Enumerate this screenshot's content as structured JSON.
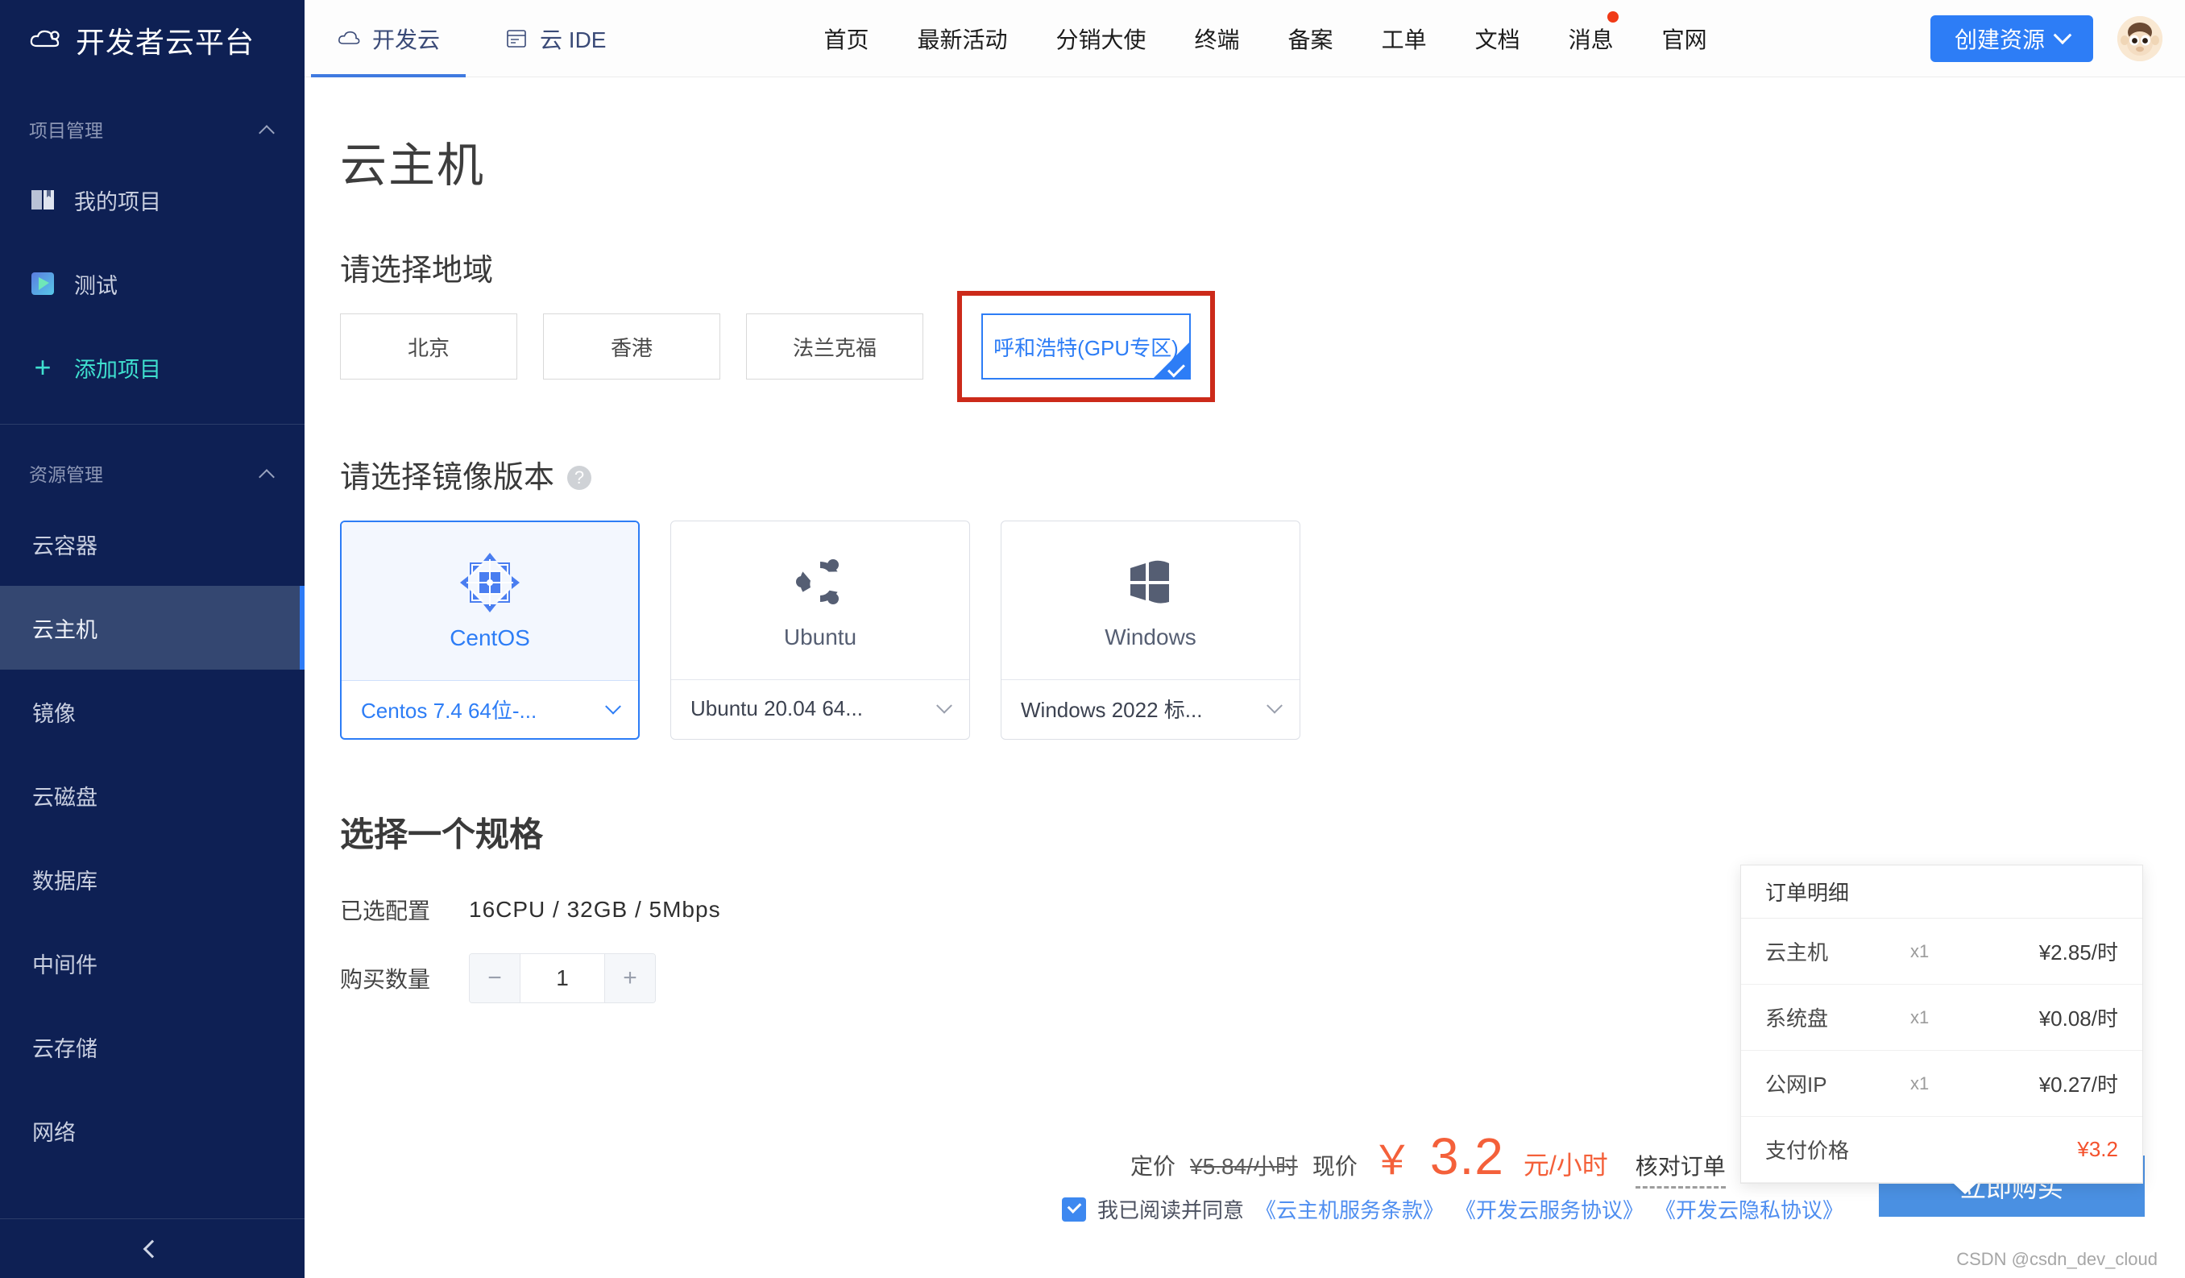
{
  "sidebar": {
    "brand": "开发者云平台",
    "groups": [
      {
        "title": "项目管理",
        "items": [
          {
            "label": "我的项目",
            "icon": "book-icon"
          },
          {
            "label": "测试",
            "icon": "project-icon"
          },
          {
            "label": "添加项目",
            "icon": "plus-icon"
          }
        ]
      },
      {
        "title": "资源管理",
        "items": [
          {
            "label": "云容器"
          },
          {
            "label": "云主机"
          },
          {
            "label": "镜像"
          },
          {
            "label": "云磁盘"
          },
          {
            "label": "数据库"
          },
          {
            "label": "中间件"
          },
          {
            "label": "云存储"
          },
          {
            "label": "网络"
          }
        ],
        "active_label": "云主机"
      }
    ],
    "collapse_icon": "chevron-left-icon"
  },
  "topnav": {
    "tabs": [
      {
        "label": "开发云",
        "icon": "cloud-icon",
        "active": true
      },
      {
        "label": "云 IDE",
        "icon": "ide-icon",
        "active": false
      }
    ],
    "links": [
      {
        "label": "首页"
      },
      {
        "label": "最新活动"
      },
      {
        "label": "分销大使"
      },
      {
        "label": "终端"
      },
      {
        "label": "备案"
      },
      {
        "label": "工单"
      },
      {
        "label": "文档"
      },
      {
        "label": "消息",
        "badge": true
      },
      {
        "label": "官网"
      }
    ],
    "create_button": "创建资源",
    "avatar": "user-avatar"
  },
  "page": {
    "title": "云主机",
    "region_section": {
      "title": "请选择地域",
      "regions": [
        {
          "label": "北京",
          "selected": false
        },
        {
          "label": "香港",
          "selected": false
        },
        {
          "label": "法兰克福",
          "selected": false
        },
        {
          "label": "呼和浩特(GPU专区)",
          "selected": true
        }
      ]
    },
    "image_section": {
      "title": "请选择镜像版本",
      "help_icon": "question-mark-icon",
      "images": [
        {
          "name": "CentOS",
          "version": "Centos 7.4 64位-...",
          "logo": "centos-logo",
          "selected": true
        },
        {
          "name": "Ubuntu",
          "version": "Ubuntu 20.04 64...",
          "logo": "ubuntu-logo",
          "selected": false
        },
        {
          "name": "Windows",
          "version": "Windows 2022 标...",
          "logo": "windows-logo",
          "selected": false
        }
      ]
    },
    "spec_section": {
      "title": "选择一个规格",
      "config_label": "已选配置",
      "config_value": "16CPU  /  32GB  /  5Mbps",
      "quantity_label": "购买数量",
      "quantity_value": "1",
      "decrement": "−",
      "increment": "+"
    }
  },
  "pricebar": {
    "list_price_label": "定价",
    "list_price": "¥5.84/小时",
    "current_price_label": "现价",
    "currency_symbol": "￥",
    "current_price": "3.2",
    "price_unit": "元/小时",
    "check_order": "核对订单",
    "agree_prefix": "我已阅读并同意",
    "agreements": [
      "《云主机服务条款》",
      "《开发云服务协议》",
      "《开发云隐私协议》"
    ],
    "buy_button": "立即购买",
    "watermark": "CSDN @csdn_dev_cloud"
  },
  "order_panel": {
    "title": "订单明细",
    "rows": [
      {
        "name": "云主机",
        "qty": "x1",
        "price": "¥2.85/时"
      },
      {
        "name": "系统盘",
        "qty": "x1",
        "price": "¥0.08/时"
      },
      {
        "name": "公网IP",
        "qty": "x1",
        "price": "¥0.27/时"
      }
    ],
    "total_label": "支付价格",
    "total_price": "¥3.2"
  },
  "colors": {
    "sidebar_bg": "#0e2054",
    "sidebar_active": "#344771",
    "accent_blue": "#2d7df6",
    "price_orange": "#f4603a",
    "annotation_red": "#cc2a1a",
    "add_project_teal": "#3fe0cf"
  }
}
